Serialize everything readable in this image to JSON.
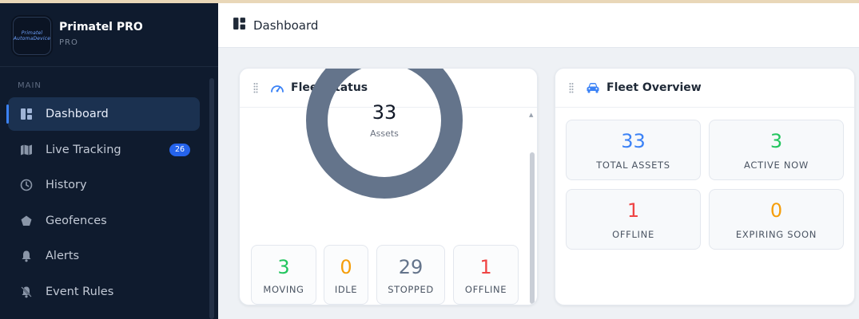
{
  "brand": {
    "name": "Primatel PRO",
    "tier": "PRO",
    "logo_text": "Primatel AutomaDevice"
  },
  "sidebar": {
    "section": "MAIN",
    "items": [
      {
        "label": "Dashboard",
        "icon": "dashboard-icon",
        "active": true
      },
      {
        "label": "Live Tracking",
        "icon": "map-icon",
        "badge": "26"
      },
      {
        "label": "History",
        "icon": "clock-icon"
      },
      {
        "label": "Geofences",
        "icon": "pentagon-icon"
      },
      {
        "label": "Alerts",
        "icon": "bell-icon"
      },
      {
        "label": "Event Rules",
        "icon": "bell-off-icon"
      }
    ]
  },
  "header": {
    "title": "Dashboard",
    "icon": "dashboard-icon"
  },
  "fleet_status": {
    "title": "Fleet Status",
    "icon": "gauge-icon",
    "total": "33",
    "total_label": "Assets",
    "donut_color": "#64748b",
    "stats": [
      {
        "value": "3",
        "label": "MOVING",
        "color": "#22c55e"
      },
      {
        "value": "0",
        "label": "IDLE",
        "color": "#f59e0b"
      },
      {
        "value": "29",
        "label": "STOPPED",
        "color": "#64748b"
      },
      {
        "value": "1",
        "label": "OFFLINE",
        "color": "#ef4444"
      }
    ]
  },
  "fleet_overview": {
    "title": "Fleet Overview",
    "icon": "car-icon",
    "tiles": [
      {
        "value": "33",
        "label": "TOTAL ASSETS",
        "color": "#3b82f6"
      },
      {
        "value": "3",
        "label": "ACTIVE NOW",
        "color": "#22c55e"
      },
      {
        "value": "1",
        "label": "OFFLINE",
        "color": "#ef4444"
      },
      {
        "value": "0",
        "label": "EXPIRING SOON",
        "color": "#f59e0b"
      }
    ]
  }
}
